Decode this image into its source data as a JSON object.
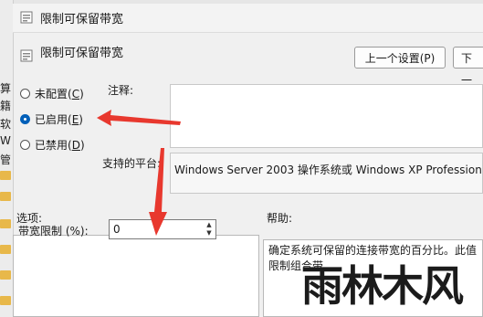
{
  "background": {
    "fragments": [
      "算",
      "籍",
      "软",
      "W",
      "管"
    ]
  },
  "dialog": {
    "title": "限制可保留带宽",
    "policy_name": "限制可保留带宽",
    "prev_button": "上一个设置(P)",
    "next_button": "下一",
    "radio_options": [
      {
        "label": "未配置(",
        "key": "C",
        "tail": ")",
        "selected": false
      },
      {
        "label": "已启用(",
        "key": "E",
        "tail": ")",
        "selected": true
      },
      {
        "label": "已禁用(",
        "key": "D",
        "tail": ")",
        "selected": false
      }
    ],
    "comment_label": "注释:",
    "supported_label": "支持的平台:",
    "supported_text": "Windows Server 2003 操作系统或 Windows XP Professional",
    "options_label": "选项:",
    "help_label": "帮助:",
    "bandwidth_label": "带宽限制 (%):",
    "bandwidth_value": "0",
    "help_text": "确定系统可保留的连接带宽的百分比。此值限制组合带"
  },
  "watermark": {
    "main": "雨林木风",
    "sub": "YLMF"
  },
  "colors": {
    "accent": "#005fb8",
    "arrow": "#e8382e"
  }
}
